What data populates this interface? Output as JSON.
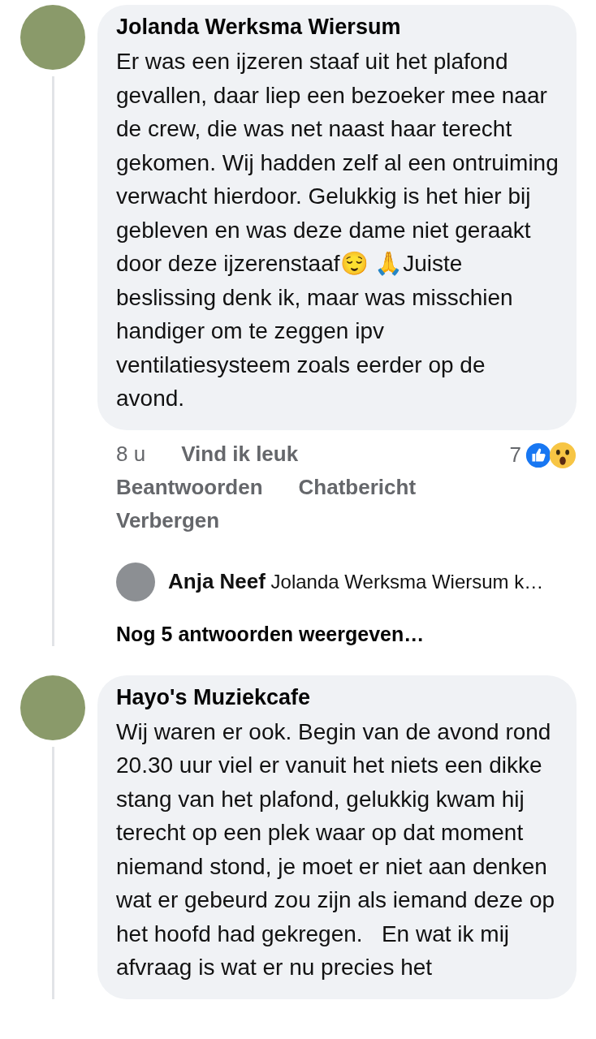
{
  "comments": [
    {
      "author": "Jolanda Werksma Wiersum",
      "text": "Er was een ijzeren staaf uit het plafond gevallen, daar liep een bezoeker mee naar de crew, die was net naast haar terecht gekomen. Wij hadden zelf al een ontruiming verwacht hierdoor. Gelukkig is het hier bij gebleven en was deze dame niet geraakt door deze ijzerenstaaf😌 🙏Juiste beslissing denk ik, maar was misschien handiger om te zeggen ipv ventilatiesysteem zoals eerder op de avond.",
      "time": "8 u",
      "actions": [
        "Vind ik leuk",
        "Beantwoorden",
        "Chatbericht",
        "Verbergen"
      ],
      "reaction_count": "7",
      "replies": [
        {
          "author": "Anja Neef",
          "text": "Jolanda Werksma Wiersum k…"
        }
      ],
      "more_replies": "Nog 5 antwoorden weergeven…"
    },
    {
      "author": "Hayo's Muziekcafe",
      "text": "Wij waren er ook. Begin van de avond rond 20.30 uur viel er vanuit het niets een dikke stang van het plafond, gelukkig kwam hij terecht op een plek waar op dat moment niemand stond, je moet er niet aan denken wat er gebeurd zou zijn als iemand deze op het hoofd had gekregen.   En wat ik mij afvraag is wat er nu precies het"
    }
  ]
}
